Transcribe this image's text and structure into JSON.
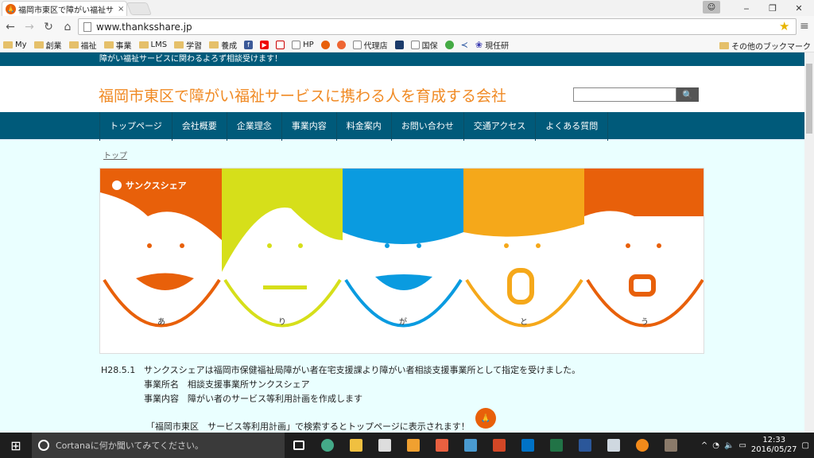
{
  "browser": {
    "tab_title": "福岡市東区で障がい福祉サ",
    "tab_close": "×",
    "url": "www.thanksshare.jp",
    "win_min": "‒",
    "win_max": "❐",
    "win_close": "✕",
    "bookmarks": [
      "My",
      "創業",
      "福祉",
      "事業",
      "LMS",
      "学習",
      "養成",
      "HP",
      "代理店",
      "国保",
      "現任研"
    ],
    "other_bookmarks": "その他のブックマーク"
  },
  "site": {
    "top_strip": "障がい福祉サービスに関わるよろず相談受けます！",
    "title": "福岡市東区で障がい福祉サービスに携わる人を育成する会社",
    "search_placeholder": "",
    "nav": [
      "トップページ",
      "会社概要",
      "企業理念",
      "事業内容",
      "料金案内",
      "お問い合わせ",
      "交通アクセス",
      "よくある質問"
    ],
    "breadcrumb": "トップ",
    "banner": {
      "brand": "サンクスシェア",
      "letters": [
        "あ",
        "り",
        "が",
        "と",
        "う"
      ]
    },
    "news": {
      "date": "H28.5.1",
      "line1": "サンクスシェアは福岡市保健福祉局障がい者在宅支援課より障がい者相談支援事業所として指定を受けました。",
      "line2": "事業所名　相談支援事業所サンクスシェア",
      "line3": "事業内容　障がい者のサービス等利用計画を作成します",
      "note": "「福岡市東区　サービス等利用計画」で検索するとトップページに表示されます！"
    }
  },
  "taskbar": {
    "cortana": "Cortanaに何か聞いてみてください。",
    "time": "12:33",
    "date": "2016/05/27"
  },
  "colors": {
    "navy": "#005a7a",
    "orange": "#e8600a",
    "yellow": "#d6df1a",
    "blue": "#0a9be0",
    "gold": "#f5a81a",
    "title_orange": "#f08a24"
  }
}
